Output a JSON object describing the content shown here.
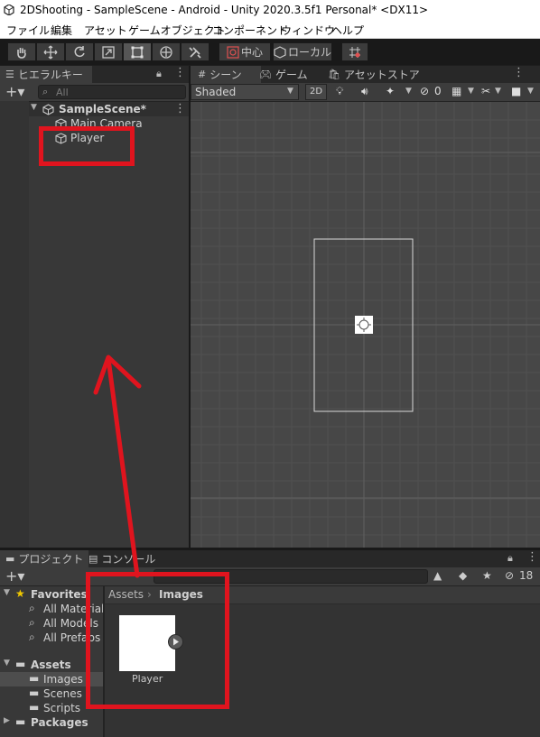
{
  "window": {
    "title": "2DShooting - SampleScene - Android - Unity 2020.3.5f1 Personal* <DX11>"
  },
  "menubar": {
    "items": [
      "ファイル",
      "編集",
      "アセット",
      "ゲームオブジェクト",
      "コンポーネント",
      "ウィンドウ",
      "ヘルプ"
    ]
  },
  "toolbar": {
    "pivot_label": "中心",
    "space_label": "ローカル"
  },
  "hierarchy": {
    "tab_label": "ヒエラルキー",
    "search_placeholder": "All",
    "scene_name": "SampleScene*",
    "items": [
      "Main Camera",
      "Player"
    ]
  },
  "scene_view": {
    "tabs": [
      "シーン",
      "ゲーム",
      "アセットストア"
    ],
    "shading_mode": "Shaded",
    "mode_2d": "2D",
    "hidden_count": "0"
  },
  "project": {
    "tabs": [
      "プロジェクト",
      "コンソール"
    ],
    "hidden_count": "18",
    "favorites_label": "Favorites",
    "favorites": [
      "All Materials",
      "All Models",
      "All Prefabs"
    ],
    "assets_label": "Assets",
    "asset_folders": [
      "Images",
      "Scenes",
      "Scripts"
    ],
    "packages_label": "Packages",
    "breadcrumb": [
      "Assets",
      "Images"
    ],
    "asset_items": [
      "Player"
    ]
  },
  "colors": {
    "annotation_red": "#e0141e",
    "editor_bg": "#383838",
    "selection": "#2c5d87"
  }
}
